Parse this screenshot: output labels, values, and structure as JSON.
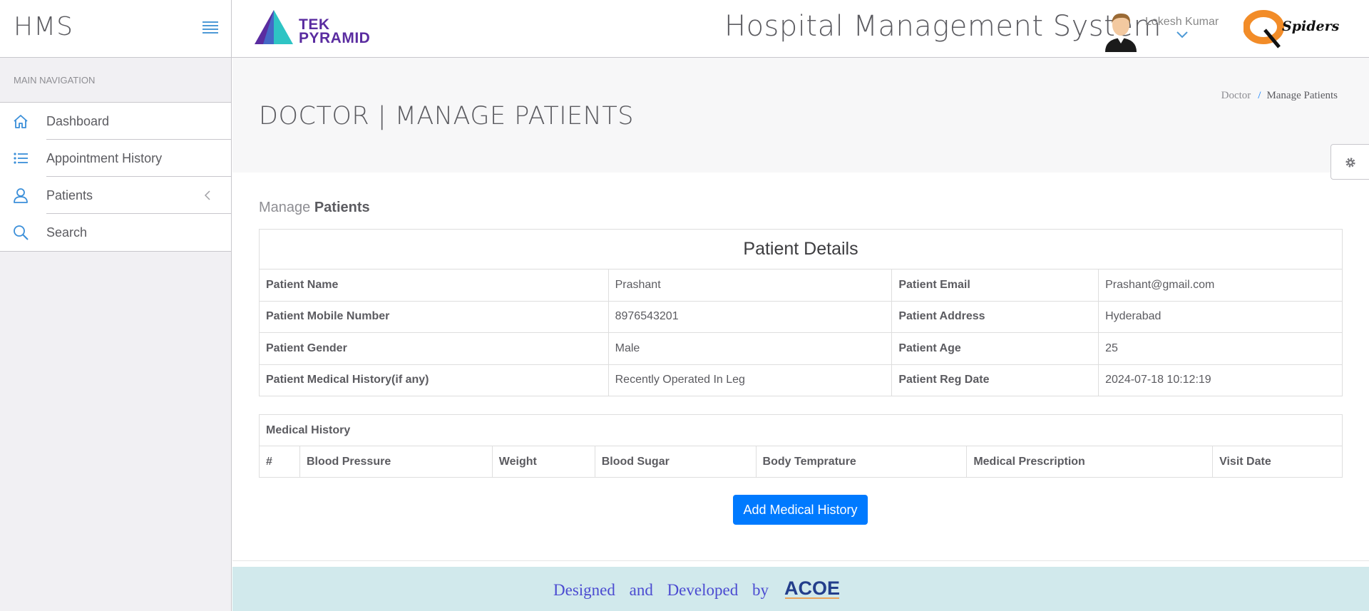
{
  "brand": {
    "name": "HMS"
  },
  "header": {
    "logo_left": {
      "line1": "TEK",
      "line2": "PYRAMID"
    },
    "title": "Hospital Management System",
    "user_name": "Lokesh Kumar",
    "logo_right": {
      "text": "Spiders"
    }
  },
  "sidebar": {
    "caption": "MAIN NAVIGATION",
    "items": [
      {
        "label": "Dashboard",
        "icon": "home-icon"
      },
      {
        "label": "Appointment History",
        "icon": "list-icon"
      },
      {
        "label": "Patients",
        "icon": "user-icon"
      },
      {
        "label": "Search",
        "icon": "search-icon"
      }
    ]
  },
  "page": {
    "title": "DOCTOR | MANAGE PATIENTS",
    "breadcrumb": [
      "Doctor",
      "Manage Patients"
    ],
    "section_title_light": "Manage",
    "section_title_bold": "Patients"
  },
  "patient_details": {
    "caption": "Patient Details",
    "rows": [
      {
        "l1": "Patient Name",
        "v1": "Prashant",
        "l2": "Patient Email",
        "v2": "Prashant@gmail.com"
      },
      {
        "l1": "Patient Mobile Number",
        "v1": "8976543201",
        "l2": "Patient Address",
        "v2": "Hyderabad"
      },
      {
        "l1": "Patient Gender",
        "v1": "Male",
        "l2": "Patient Age",
        "v2": "25"
      },
      {
        "l1": "Patient Medical History(if any)",
        "v1": "Recently Operated In Leg",
        "l2": "Patient Reg Date",
        "v2": "2024-07-18 10:12:19"
      }
    ]
  },
  "medical_history": {
    "caption": "Medical History",
    "columns": [
      "#",
      "Blood Pressure",
      "Weight",
      "Blood Sugar",
      "Body Temprature",
      "Medical Prescription",
      "Visit Date"
    ]
  },
  "actions": {
    "add_medical_history": "Add Medical History"
  },
  "footer": {
    "text": "Designed and Developed by",
    "logo_text": "ACOE"
  },
  "colors": {
    "accent": "#007aff",
    "footer_bg": "#d1e9ec",
    "sidebar_bg": "#f1f0f3",
    "text": "#5b5b60"
  }
}
